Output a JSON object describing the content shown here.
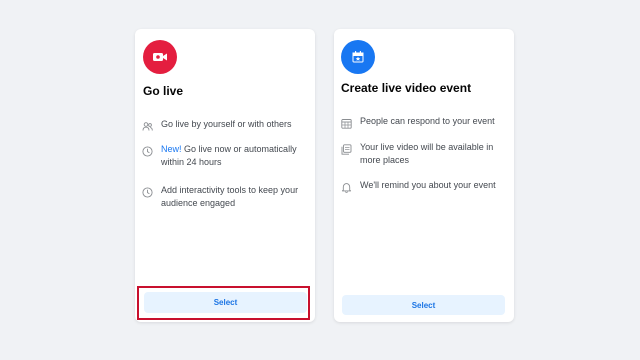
{
  "colors": {
    "background": "#f0f2f5",
    "live_badge": "#e41e3f",
    "event_badge": "#1877f2",
    "button_bg": "#e7f3ff",
    "button_text": "#1b74e4",
    "new_tag": "#1877f2",
    "highlight": "#c8102e"
  },
  "go_live": {
    "badge_icon": "video-camera-icon",
    "title": "Go live",
    "features": [
      {
        "icon": "people-icon",
        "text": "Go live by yourself or with others"
      },
      {
        "icon": "clock-icon",
        "new_tag": "New!",
        "text": " Go live now or automatically within 24 hours"
      },
      {
        "icon": "clock-icon",
        "text": "Add interactivity tools to keep your audience engaged"
      }
    ],
    "button_label": "Select"
  },
  "live_event": {
    "badge_icon": "calendar-star-icon",
    "title": "Create live video event",
    "features": [
      {
        "icon": "calendar-grid-icon",
        "text": "People can respond to your event"
      },
      {
        "icon": "documents-icon",
        "text": "Your live video will be available in more places"
      },
      {
        "icon": "bell-icon",
        "text": "We'll remind you about your event"
      }
    ],
    "button_label": "Select"
  }
}
